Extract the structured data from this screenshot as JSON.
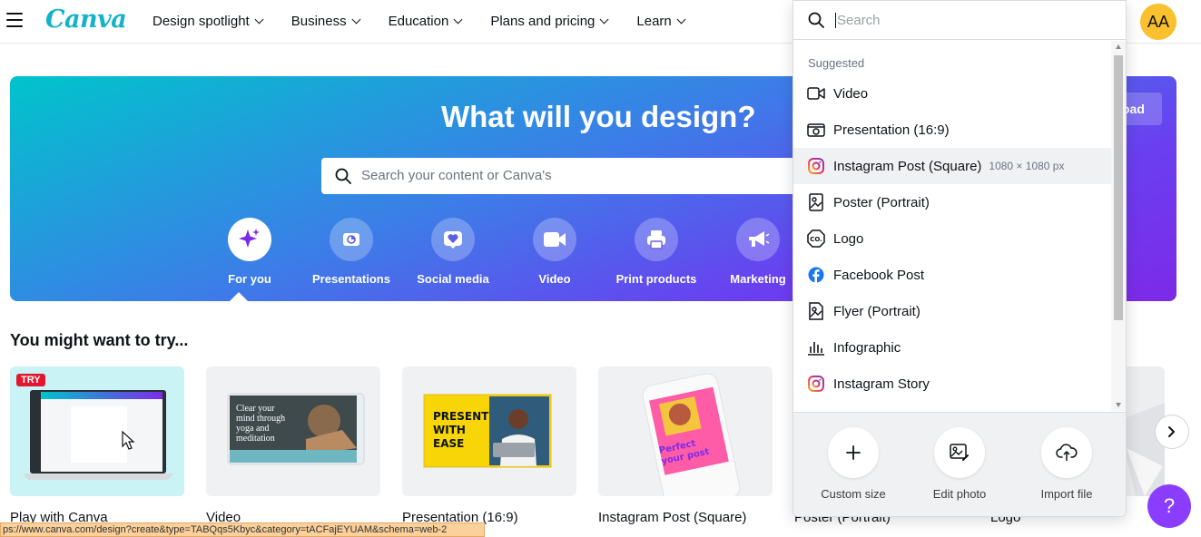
{
  "header": {
    "logo": "Canva",
    "nav": [
      {
        "label": "Design spotlight"
      },
      {
        "label": "Business"
      },
      {
        "label": "Education"
      },
      {
        "label": "Plans and pricing"
      },
      {
        "label": "Learn"
      }
    ],
    "avatar_initials": "AA"
  },
  "hero": {
    "title": "What will you design?",
    "search_placeholder": "Search your content or Canva's",
    "upload_label": "oad",
    "categories": [
      {
        "label": "For you",
        "icon": "sparkle-icon"
      },
      {
        "label": "Presentations",
        "icon": "presentation-icon"
      },
      {
        "label": "Social media",
        "icon": "heart-icon"
      },
      {
        "label": "Video",
        "icon": "video-icon"
      },
      {
        "label": "Print products",
        "icon": "printer-icon"
      },
      {
        "label": "Marketing",
        "icon": "megaphone-icon"
      }
    ]
  },
  "suggestions_section": {
    "title": "You might want to try...",
    "cards": [
      {
        "label": "Play with Canva",
        "badge": "TRY"
      },
      {
        "label": "Video",
        "thumb_text": "Clear your mind through yoga and meditation"
      },
      {
        "label": "Presentation (16:9)",
        "thumb_text": "PRESENT WITH EASE"
      },
      {
        "label": "Instagram Post (Square)",
        "thumb_text": "Perfect your post"
      },
      {
        "label": "Poster (Portrait)"
      },
      {
        "label": "Logo"
      }
    ]
  },
  "dropdown": {
    "search_placeholder": "Search",
    "heading": "Suggested",
    "items": [
      {
        "label": "Video",
        "icon": "video-icon"
      },
      {
        "label": "Presentation (16:9)",
        "icon": "presentation-icon"
      },
      {
        "label": "Instagram Post (Square)",
        "icon": "instagram-icon",
        "dimensions": "1080 × 1080 px",
        "highlighted": true
      },
      {
        "label": "Poster (Portrait)",
        "icon": "poster-icon"
      },
      {
        "label": "Logo",
        "icon": "logo-icon"
      },
      {
        "label": "Facebook Post",
        "icon": "facebook-icon"
      },
      {
        "label": "Flyer (Portrait)",
        "icon": "flyer-icon"
      },
      {
        "label": "Infographic",
        "icon": "infographic-icon"
      },
      {
        "label": "Instagram Story",
        "icon": "instagram-icon"
      }
    ],
    "actions": [
      {
        "label": "Custom size",
        "icon": "plus-icon"
      },
      {
        "label": "Edit photo",
        "icon": "image-edit-icon"
      },
      {
        "label": "Import file",
        "icon": "cloud-upload-icon"
      }
    ]
  },
  "help_label": "?",
  "status_url": "ps://www.canva.com/design?create&type=TABQqs5Kbyc&category=tACFajEYUAM&schema=web-2",
  "colors": {
    "brand_teal": "#00c4cc",
    "brand_purple": "#7d2ae8",
    "help_purple": "#8b3dff",
    "avatar_yellow": "#fbc02d"
  }
}
